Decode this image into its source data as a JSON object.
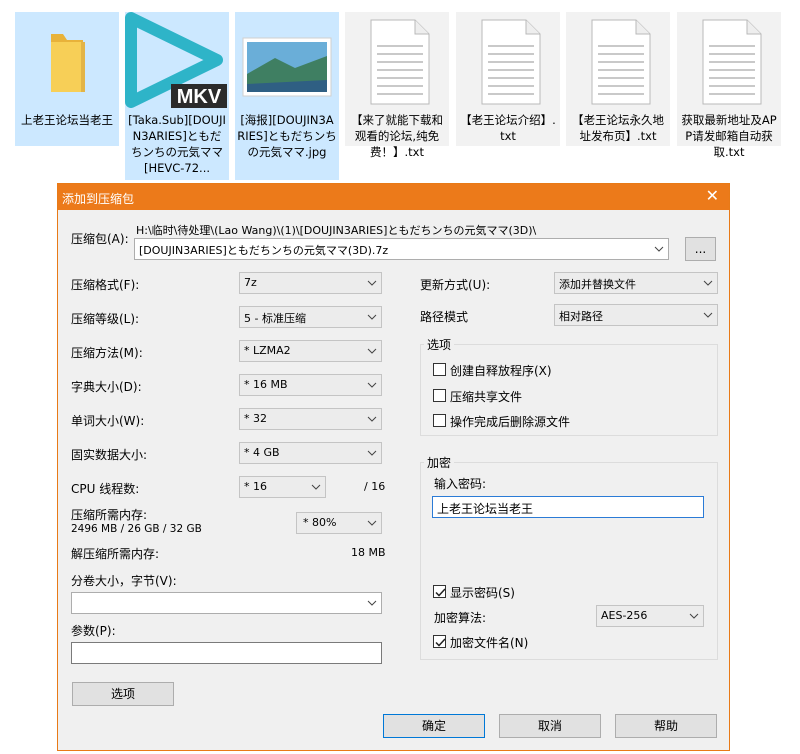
{
  "files": [
    {
      "name": "上老王论坛当老王",
      "icon": "folder-icon"
    },
    {
      "name": "[Taka.Sub][DOUJIN3ARIES]ともだちンちの元気ママ[HEVC-72...",
      "icon": "mkv-video-icon",
      "badge": "MKV"
    },
    {
      "name": "[海报][DOUJIN3ARIES]ともだちンちの元気ママ.jpg",
      "icon": "image-thumbnail-icon"
    },
    {
      "name": "【来了就能下载和观看的论坛,纯免费！】.txt",
      "icon": "text-file-icon"
    },
    {
      "name": "【老王论坛介绍】.txt",
      "icon": "text-file-icon"
    },
    {
      "name": "【老王论坛永久地址发布页】.txt",
      "icon": "text-file-icon"
    },
    {
      "name": "获取最新地址及APP请发邮箱自动获取.txt",
      "icon": "text-file-icon"
    }
  ],
  "dialog": {
    "title": "添加到压缩包",
    "close": "✕",
    "archive": {
      "label": "压缩包(A):",
      "path": "H:\\临时\\待处理\\(Lao Wang)\\(1)\\[DOUJIN3ARIES]ともだちンちの元気ママ(3D)\\",
      "filename": "[DOUJIN3ARIES]ともだちンちの元気ママ(3D).7z",
      "browse": "..."
    },
    "left": {
      "format": {
        "label": "压缩格式(F):",
        "value": "7z"
      },
      "level": {
        "label": "压缩等级(L):",
        "value": "5 - 标准压缩"
      },
      "method": {
        "label": "压缩方法(M):",
        "value": "* LZMA2"
      },
      "dict": {
        "label": "字典大小(D):",
        "value": "* 16 MB"
      },
      "word": {
        "label": "单词大小(W):",
        "value": "* 32"
      },
      "solid": {
        "label": "固实数据大小:",
        "value": "* 4 GB"
      },
      "cpu": {
        "label": "CPU 线程数:",
        "value": "* 16",
        "max": "/ 16"
      },
      "mem": {
        "label": "压缩所需内存:",
        "detail": "2496 MB / 26 GB / 32 GB",
        "value": "* 80%"
      },
      "decomp": {
        "label": "解压缩所需内存:",
        "value": "18 MB"
      },
      "volume": {
        "label": "分卷大小，字节(V):",
        "value": ""
      },
      "params": {
        "label": "参数(P):",
        "value": ""
      },
      "options_button": "选项"
    },
    "right": {
      "update": {
        "label": "更新方式(U):",
        "value": "添加并替换文件"
      },
      "path": {
        "label": "路径模式",
        "value": "相对路径"
      },
      "options": {
        "title": "选项",
        "sfx": {
          "label": "创建自释放程序(X)",
          "checked": false
        },
        "shared": {
          "label": "压缩共享文件",
          "checked": false
        },
        "delete": {
          "label": "操作完成后删除源文件",
          "checked": false
        }
      },
      "encryption": {
        "title": "加密",
        "password_label": "输入密码:",
        "password_value": "上老王论坛当老王",
        "show_password": {
          "label": "显示密码(S)",
          "checked": true
        },
        "method_label": "加密算法:",
        "method_value": "AES-256",
        "encrypt_names": {
          "label": "加密文件名(N)",
          "checked": true
        }
      }
    },
    "buttons": {
      "ok": "确定",
      "cancel": "取消",
      "help": "帮助"
    }
  }
}
